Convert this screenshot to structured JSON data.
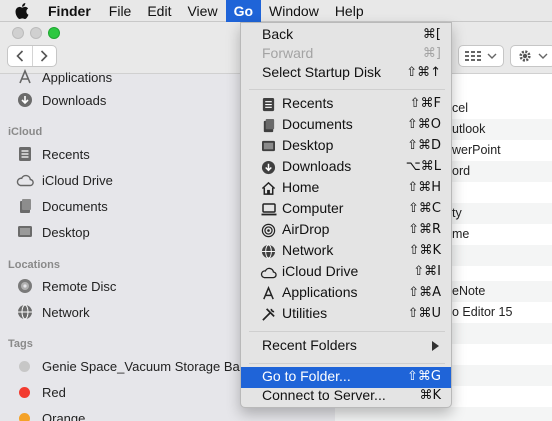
{
  "menubar": {
    "app_name": "Finder",
    "items": [
      "File",
      "Edit",
      "View",
      "Go",
      "Window",
      "Help"
    ]
  },
  "sidebar": {
    "top_items": [
      {
        "label": "Applications",
        "icon": "applications-icon"
      },
      {
        "label": "Downloads",
        "icon": "downloads-icon"
      }
    ],
    "icloud_header": "iCloud",
    "icloud_items": [
      {
        "label": "Recents",
        "icon": "recents-icon"
      },
      {
        "label": "iCloud Drive",
        "icon": "cloud-icon"
      },
      {
        "label": "Documents",
        "icon": "documents-icon"
      },
      {
        "label": "Desktop",
        "icon": "desktop-icon"
      }
    ],
    "locations_header": "Locations",
    "location_items": [
      {
        "label": "Remote Disc",
        "icon": "disc-icon"
      },
      {
        "label": "Network",
        "icon": "network-icon"
      }
    ],
    "tags_header": "Tags",
    "tag_items": [
      {
        "label": "Genie Space_Vacuum Storage Ba",
        "color": "#c7c7c7"
      },
      {
        "label": "Red",
        "color": "#f23b30"
      },
      {
        "label": "Orange",
        "color": "#f4a228"
      }
    ]
  },
  "content_rows": [
    "cel",
    "utlook",
    "werPoint",
    "ord",
    "",
    "ty",
    "me",
    "",
    "",
    "eNote",
    "o Editor 15",
    "",
    "",
    "",
    "",
    ""
  ],
  "go_menu": {
    "items": [
      {
        "label": "Back",
        "shortcut": "⌘[",
        "disabled": false
      },
      {
        "label": "Forward",
        "shortcut": "⌘]",
        "disabled": true
      },
      {
        "label": "Select Startup Disk",
        "shortcut": "⇧⌘↑",
        "disabled": false
      },
      {
        "label": "Recents",
        "shortcut": "⇧⌘F",
        "icon": "recents-icon"
      },
      {
        "label": "Documents",
        "shortcut": "⇧⌘O",
        "icon": "documents-icon"
      },
      {
        "label": "Desktop",
        "shortcut": "⇧⌘D",
        "icon": "desktop-icon"
      },
      {
        "label": "Downloads",
        "shortcut": "⌥⌘L",
        "icon": "downloads-icon"
      },
      {
        "label": "Home",
        "shortcut": "⇧⌘H",
        "icon": "home-icon"
      },
      {
        "label": "Computer",
        "shortcut": "⇧⌘C",
        "icon": "computer-icon"
      },
      {
        "label": "AirDrop",
        "shortcut": "⇧⌘R",
        "icon": "airdrop-icon"
      },
      {
        "label": "Network",
        "shortcut": "⇧⌘K",
        "icon": "network-icon"
      },
      {
        "label": "iCloud Drive",
        "shortcut": "⇧⌘I",
        "icon": "cloud-icon"
      },
      {
        "label": "Applications",
        "shortcut": "⇧⌘A",
        "icon": "applications-icon"
      },
      {
        "label": "Utilities",
        "shortcut": "⇧⌘U",
        "icon": "utilities-icon"
      },
      {
        "label": "Recent Folders",
        "shortcut": "",
        "submenu": true
      },
      {
        "label": "Go to Folder...",
        "shortcut": "⇧⌘G",
        "highlighted": true
      },
      {
        "label": "Connect to Server...",
        "shortcut": "⌘K"
      }
    ]
  },
  "colors": {
    "highlight": "#1f64d8",
    "menu_bg": "#e4e4e4",
    "sidebar_bg": "#e6e6ea"
  }
}
